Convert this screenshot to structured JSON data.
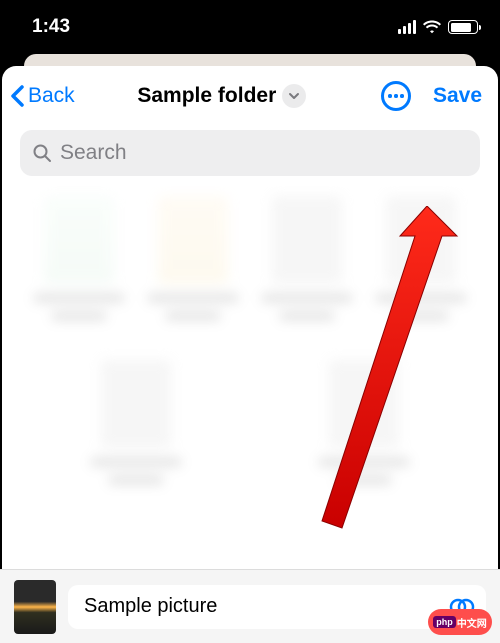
{
  "status": {
    "time": "1:43"
  },
  "nav": {
    "back_label": "Back",
    "title": "Sample folder",
    "save_label": "Save"
  },
  "search": {
    "placeholder": "Search"
  },
  "bottom": {
    "filename": "Sample picture"
  },
  "watermark": {
    "a": "php",
    "b": "中文网"
  },
  "colors": {
    "accent": "#007aff",
    "arrow": "#ff0000"
  }
}
